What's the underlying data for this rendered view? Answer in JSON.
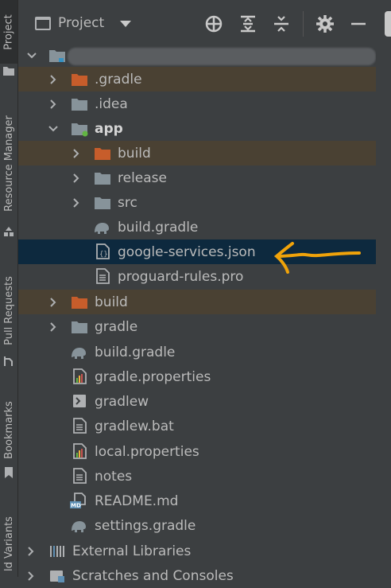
{
  "tool_strip": {
    "tabs": [
      {
        "label": "Project",
        "active": true
      },
      {
        "label": "Resource Manager",
        "active": false
      },
      {
        "label": "Pull Requests",
        "active": false
      },
      {
        "label": "Bookmarks",
        "active": false
      },
      {
        "label": "ld Variants",
        "active": false
      }
    ]
  },
  "header": {
    "title": "Project",
    "icons": [
      "project-view-icon",
      "dropdown-chevron-icon",
      "crosshair-icon",
      "expand-all-icon",
      "collapse-all-icon",
      "gear-icon",
      "minimize-icon"
    ]
  },
  "tree": {
    "root_label_redacted": true,
    "items": [
      {
        "label": ".gradle",
        "icon": "folder-excluded",
        "expandable": true,
        "expanded": false,
        "excluded": true
      },
      {
        "label": ".idea",
        "icon": "folder",
        "expandable": true,
        "expanded": false
      },
      {
        "label": "app",
        "icon": "module-folder",
        "expandable": true,
        "expanded": true,
        "bold": true
      },
      {
        "label": "build",
        "icon": "folder-excluded",
        "expandable": true,
        "expanded": false,
        "excluded": true
      },
      {
        "label": "release",
        "icon": "folder",
        "expandable": true,
        "expanded": false
      },
      {
        "label": "src",
        "icon": "folder",
        "expandable": true,
        "expanded": false
      },
      {
        "label": "build.gradle",
        "icon": "gradle-elephant"
      },
      {
        "label": "google-services.json",
        "icon": "json-file",
        "selected": true
      },
      {
        "label": "proguard-rules.pro",
        "icon": "text-file"
      },
      {
        "label": "build",
        "icon": "folder-excluded",
        "expandable": true,
        "expanded": false,
        "excluded": true
      },
      {
        "label": "gradle",
        "icon": "folder",
        "expandable": true,
        "expanded": false
      },
      {
        "label": "build.gradle",
        "icon": "gradle-elephant"
      },
      {
        "label": "gradle.properties",
        "icon": "properties-file"
      },
      {
        "label": "gradlew",
        "icon": "shell-script"
      },
      {
        "label": "gradlew.bat",
        "icon": "text-file"
      },
      {
        "label": "local.properties",
        "icon": "properties-file"
      },
      {
        "label": "notes",
        "icon": "text-file"
      },
      {
        "label": "README.md",
        "icon": "markdown-file"
      },
      {
        "label": "settings.gradle",
        "icon": "gradle-elephant"
      },
      {
        "label": "External Libraries",
        "icon": "libraries",
        "expandable": true,
        "expanded": false
      },
      {
        "label": "Scratches and Consoles",
        "icon": "scratches",
        "expandable": true,
        "expanded": false
      }
    ]
  },
  "colors": {
    "background": "#3c3f41",
    "selection": "#0d293e",
    "excluded_row": "#4a4133",
    "excluded_folder": "#c75d2b",
    "folder": "#87939a",
    "annotation_arrow": "#f0a30a"
  }
}
